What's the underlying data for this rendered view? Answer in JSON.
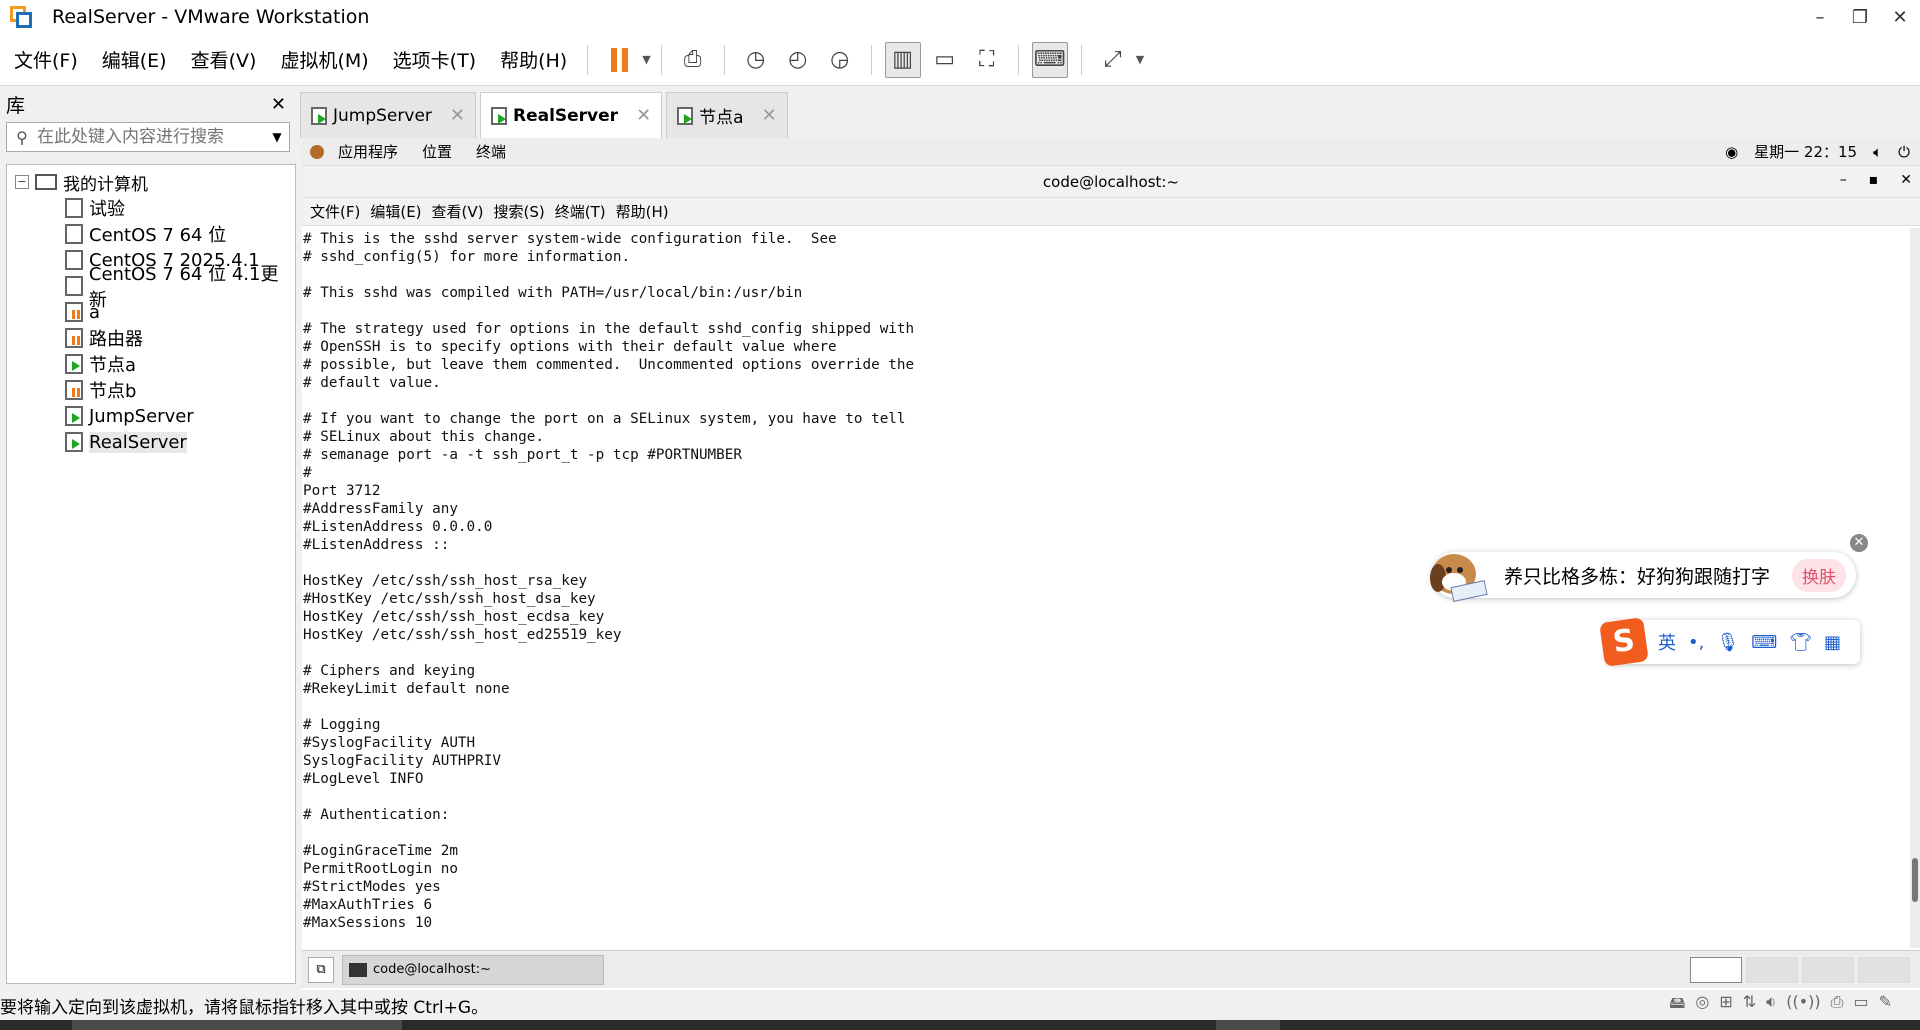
{
  "window": {
    "title": "RealServer - VMware Workstation",
    "minimize": "–",
    "maximize": "❐",
    "close": "✕"
  },
  "menu": [
    "文件(F)",
    "编辑(E)",
    "查看(V)",
    "虚拟机(M)",
    "选项卡(T)",
    "帮助(H)"
  ],
  "library": {
    "title": "库",
    "close": "✕",
    "search_placeholder": "在此处键入内容进行搜索",
    "root": "我的计算机",
    "items": [
      {
        "label": "试验",
        "state": "off"
      },
      {
        "label": "CentOS 7 64 位",
        "state": "off"
      },
      {
        "label": "CentOS 7 2025.4.1",
        "state": "off"
      },
      {
        "label": "CentOS 7 64 位 4.1更新",
        "state": "off"
      },
      {
        "label": "a",
        "state": "paused"
      },
      {
        "label": "路由器",
        "state": "paused"
      },
      {
        "label": "节点a",
        "state": "running"
      },
      {
        "label": "节点b",
        "state": "paused"
      },
      {
        "label": "JumpServer",
        "state": "running"
      },
      {
        "label": "RealServer",
        "state": "running",
        "selected": true
      }
    ]
  },
  "tabs": [
    {
      "label": "JumpServer",
      "close": "✕",
      "active": false
    },
    {
      "label": "RealServer",
      "close": "✕",
      "active": true
    },
    {
      "label": "节点a",
      "close": "✕",
      "active": false
    }
  ],
  "gnome": {
    "apps": "应用程序",
    "places": "位置",
    "terminal": "终端",
    "clock": "星期一 22：15"
  },
  "terminal": {
    "title": "code@localhost:~",
    "min": "–",
    "max": "▪",
    "close": "✕",
    "menu": [
      "文件(F)",
      "编辑(E)",
      "查看(V)",
      "搜索(S)",
      "终端(T)",
      "帮助(H)"
    ],
    "content": "# This is the sshd server system-wide configuration file.  See\n# sshd_config(5) for more information.\n\n# This sshd was compiled with PATH=/usr/local/bin:/usr/bin\n\n# The strategy used for options in the default sshd_config shipped with\n# OpenSSH is to specify options with their default value where\n# possible, but leave them commented.  Uncommented options override the\n# default value.\n\n# If you want to change the port on a SELinux system, you have to tell\n# SELinux about this change.\n# semanage port -a -t ssh_port_t -p tcp #PORTNUMBER\n#\nPort 3712\n#AddressFamily any\n#ListenAddress 0.0.0.0\n#ListenAddress ::\n\nHostKey /etc/ssh/ssh_host_rsa_key\n#HostKey /etc/ssh/ssh_host_dsa_key\nHostKey /etc/ssh/ssh_host_ecdsa_key\nHostKey /etc/ssh/ssh_host_ed25519_key\n\n# Ciphers and keying\n#RekeyLimit default none\n\n# Logging\n#SyslogFacility AUTH\nSyslogFacility AUTHPRIV\n#LogLevel INFO\n\n# Authentication:\n\n#LoginGraceTime 2m\nPermitRootLogin no\n#StrictModes yes\n#MaxAuthTries 6\n#MaxSessions 10"
  },
  "taskbar": {
    "task": "code@localhost:~"
  },
  "ime": {
    "tip": "养只比格多栋：好狗狗跟随打字",
    "skin": "换肤",
    "lang": "英",
    "punct": "•,",
    "close": "✕",
    "logo": "S"
  },
  "status": {
    "message": "要将输入定向到该虚拟机，请将鼠标指针移入其中或按 Ctrl+G。"
  },
  "colors": {
    "pause": "#f07b1a",
    "running": "#1ea61e",
    "ime_logo": "#f25c1e"
  }
}
